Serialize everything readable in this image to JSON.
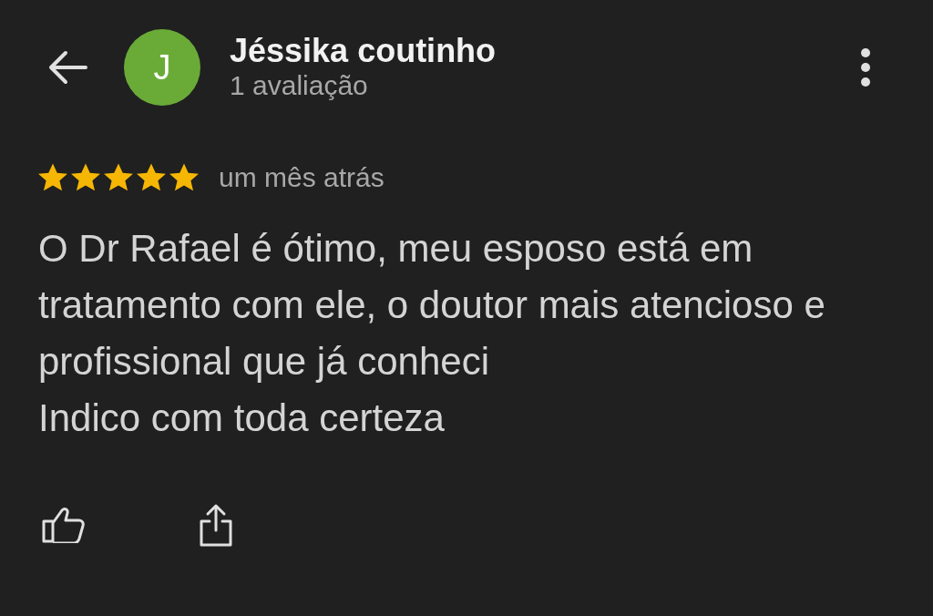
{
  "reviewer": {
    "initial": "J",
    "name": "Jéssika coutinho",
    "review_count": "1 avaliação"
  },
  "review": {
    "stars": 5,
    "time": "um mês atrás",
    "paragraphs": [
      "O Dr Rafael é ótimo, meu esposo está em tratamento com ele, o doutor mais atencioso e profissional que já conheci",
      "Indico com toda certeza"
    ]
  }
}
